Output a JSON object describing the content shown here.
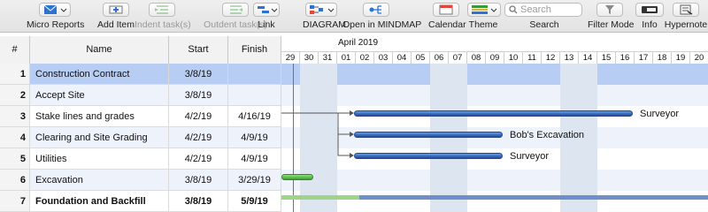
{
  "toolbar": {
    "items": [
      {
        "label": "Micro Reports",
        "icon": "report-icon"
      },
      {
        "label": "Add Item",
        "icon": "add-item-icon"
      },
      {
        "label": "Indent task(s)",
        "icon": "indent-icon"
      },
      {
        "label": "Outdent task(s)",
        "icon": "outdent-icon"
      },
      {
        "label": "Link",
        "icon": "link-icon"
      },
      {
        "label": "DIAGRAM",
        "icon": "diagram-icon"
      },
      {
        "label": "Open in MINDMAP",
        "icon": "mindmap-icon"
      },
      {
        "label": "Calendar",
        "icon": "calendar-icon"
      },
      {
        "label": "Theme",
        "icon": "theme-icon"
      },
      {
        "label": "Search",
        "placeholder": "Search"
      },
      {
        "label": "Filter Mode",
        "icon": "filter-icon"
      },
      {
        "label": "Info",
        "icon": "info-icon"
      },
      {
        "label": "Hypernote",
        "icon": "hypernote-icon"
      }
    ]
  },
  "table": {
    "headers": {
      "num": "#",
      "name": "Name",
      "start": "Start",
      "finish": "Finish"
    },
    "rows": [
      {
        "num": "1",
        "name": "Construction Contract",
        "start": "3/8/19",
        "finish": ""
      },
      {
        "num": "2",
        "name": "Accept Site",
        "start": "3/8/19",
        "finish": ""
      },
      {
        "num": "3",
        "name": "Stake lines and grades",
        "start": "4/2/19",
        "finish": "4/16/19"
      },
      {
        "num": "4",
        "name": "Clearing and Site Grading",
        "start": "4/2/19",
        "finish": "4/9/19"
      },
      {
        "num": "5",
        "name": "Utilities",
        "start": "4/2/19",
        "finish": "4/9/19"
      },
      {
        "num": "6",
        "name": "Excavation",
        "start": "3/8/19",
        "finish": "3/29/19"
      },
      {
        "num": "7",
        "name": "Foundation and Backfill",
        "start": "3/8/19",
        "finish": "5/9/19"
      }
    ]
  },
  "gantt": {
    "month": "April 2019",
    "days": [
      "29",
      "30",
      "31",
      "01",
      "02",
      "03",
      "04",
      "05",
      "06",
      "07",
      "08",
      "09",
      "10",
      "11",
      "12",
      "13",
      "14",
      "15",
      "16",
      "17",
      "18",
      "19",
      "20"
    ],
    "resources": [
      "Surveyor",
      "Bob's Excavation",
      "Surveyor"
    ]
  },
  "colors": {
    "selected_row": "#b7cdf3",
    "alt_row": "#eef2fb",
    "weekend_shade": "#dde5f1",
    "task_bar": "#2f5fb4",
    "progress_bar": "#3ea12f"
  }
}
